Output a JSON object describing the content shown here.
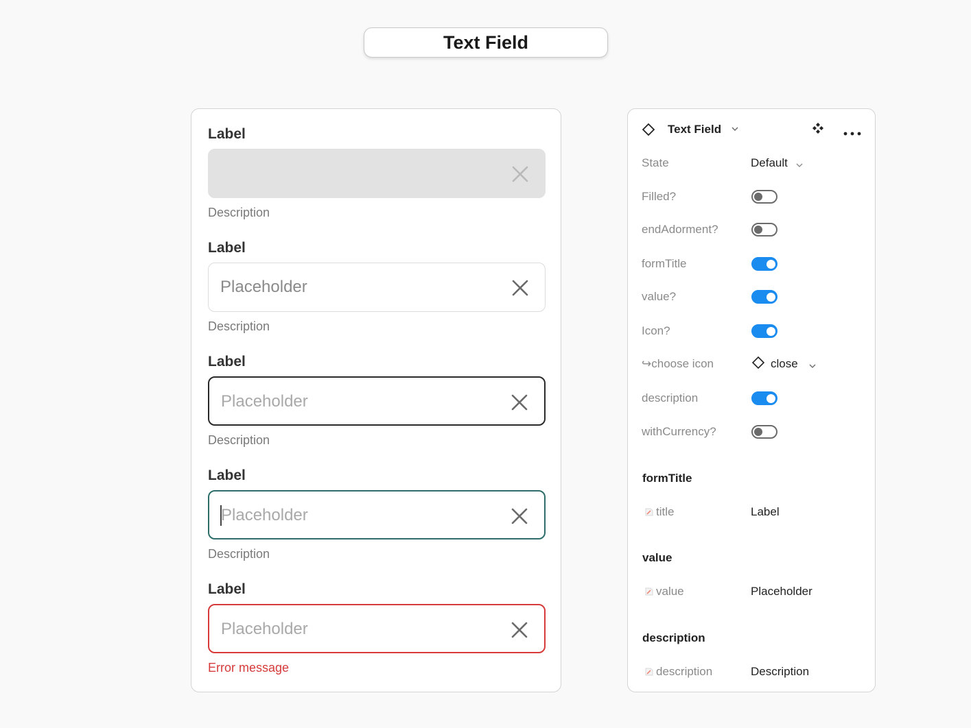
{
  "header": {
    "title": "Text Field"
  },
  "variants": [
    {
      "state": "disabled",
      "label": "Label",
      "placeholder": "",
      "description": "Description"
    },
    {
      "state": "default",
      "label": "Label",
      "placeholder": "Placeholder",
      "description": "Description"
    },
    {
      "state": "hover",
      "label": "Label",
      "placeholder": "Placeholder",
      "description": "Description"
    },
    {
      "state": "focused",
      "label": "Label",
      "placeholder": "Placeholder",
      "description": "Description"
    },
    {
      "state": "error",
      "label": "Label",
      "placeholder": "Placeholder",
      "description": "Error message"
    }
  ],
  "panel": {
    "component_name": "Text Field",
    "component_icon": "component-diamond-icon",
    "properties": [
      {
        "key": "State",
        "type": "select",
        "value": "Default"
      },
      {
        "key": "Filled?",
        "type": "toggle",
        "on": false
      },
      {
        "key": "endAdorment?",
        "type": "toggle",
        "on": false
      },
      {
        "key": "formTitle",
        "type": "toggle",
        "on": true
      },
      {
        "key": "value?",
        "type": "toggle",
        "on": true
      },
      {
        "key": "Icon?",
        "type": "toggle",
        "on": true
      },
      {
        "key": "choose icon",
        "type": "instance",
        "value": "close",
        "prefix_glyph": "↪"
      },
      {
        "key": "description",
        "type": "toggle",
        "on": true
      },
      {
        "key": "withCurrency?",
        "type": "toggle",
        "on": false
      }
    ],
    "sections": [
      {
        "title": "formTitle",
        "key": "title",
        "value": "Label"
      },
      {
        "title": "value",
        "key": "value",
        "value": "Placeholder"
      },
      {
        "title": "description",
        "key": "description",
        "value": "Description"
      }
    ]
  },
  "colors": {
    "toggle_on": "#1a8cf0",
    "focus_border": "#2e6e6a",
    "error": "#d63a3a",
    "disabled_fill": "#e2e2e2"
  }
}
